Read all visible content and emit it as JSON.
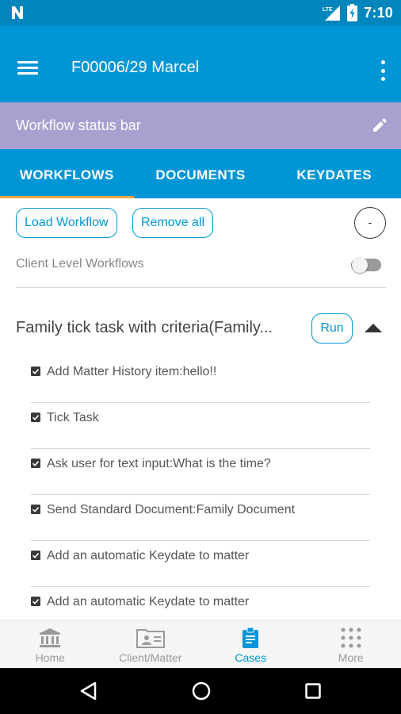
{
  "status_bar": {
    "time": "7:10",
    "icons": [
      "n-notification-icon",
      "lte-signal-icon",
      "battery-charging-icon"
    ]
  },
  "app_bar": {
    "title": "F00006/29 Marcel",
    "icons": [
      "hamburger-menu-icon",
      "overflow-menu-icon"
    ]
  },
  "workflow_status_bar": {
    "label": "Workflow status bar",
    "icon": "edit-pencil-icon"
  },
  "tabs": [
    {
      "label": "WORKFLOWS",
      "active": true
    },
    {
      "label": "DOCUMENTS",
      "active": false
    },
    {
      "label": "KEYDATES",
      "active": false
    }
  ],
  "actions": {
    "load_workflow": "Load Workflow",
    "remove_all": "Remove all",
    "circle_button": "-"
  },
  "client_level": {
    "label": "Client Level Workflows",
    "toggle_on": false
  },
  "workflow": {
    "title": "Family tick task with criteria(Family...",
    "run_label": "Run",
    "expanded": true,
    "tasks": [
      {
        "label": "Add Matter History item:hello!!",
        "checked": true
      },
      {
        "label": "Tick Task",
        "checked": true
      },
      {
        "label": "Ask user for text input:What is the time?",
        "checked": true
      },
      {
        "label": "Send Standard Document:Family Document",
        "checked": true
      },
      {
        "label": "Add an automatic Keydate to matter",
        "checked": true
      },
      {
        "label": "Add an automatic Keydate to matter",
        "checked": true
      }
    ]
  },
  "bottom_nav": [
    {
      "label": "Home",
      "icon": "bank-building-icon",
      "active": false
    },
    {
      "label": "Client/Matter",
      "icon": "contact-folder-icon",
      "active": false
    },
    {
      "label": "Cases",
      "icon": "clipboard-icon",
      "active": true
    },
    {
      "label": "More",
      "icon": "grid-dots-icon",
      "active": false
    }
  ],
  "colors": {
    "primary": "#0096d6",
    "status_bar": "#0086bd",
    "workflow_bar": "#a8a0cf",
    "tab_indicator": "#f5a742",
    "inactive_nav": "#9a9a9a"
  }
}
